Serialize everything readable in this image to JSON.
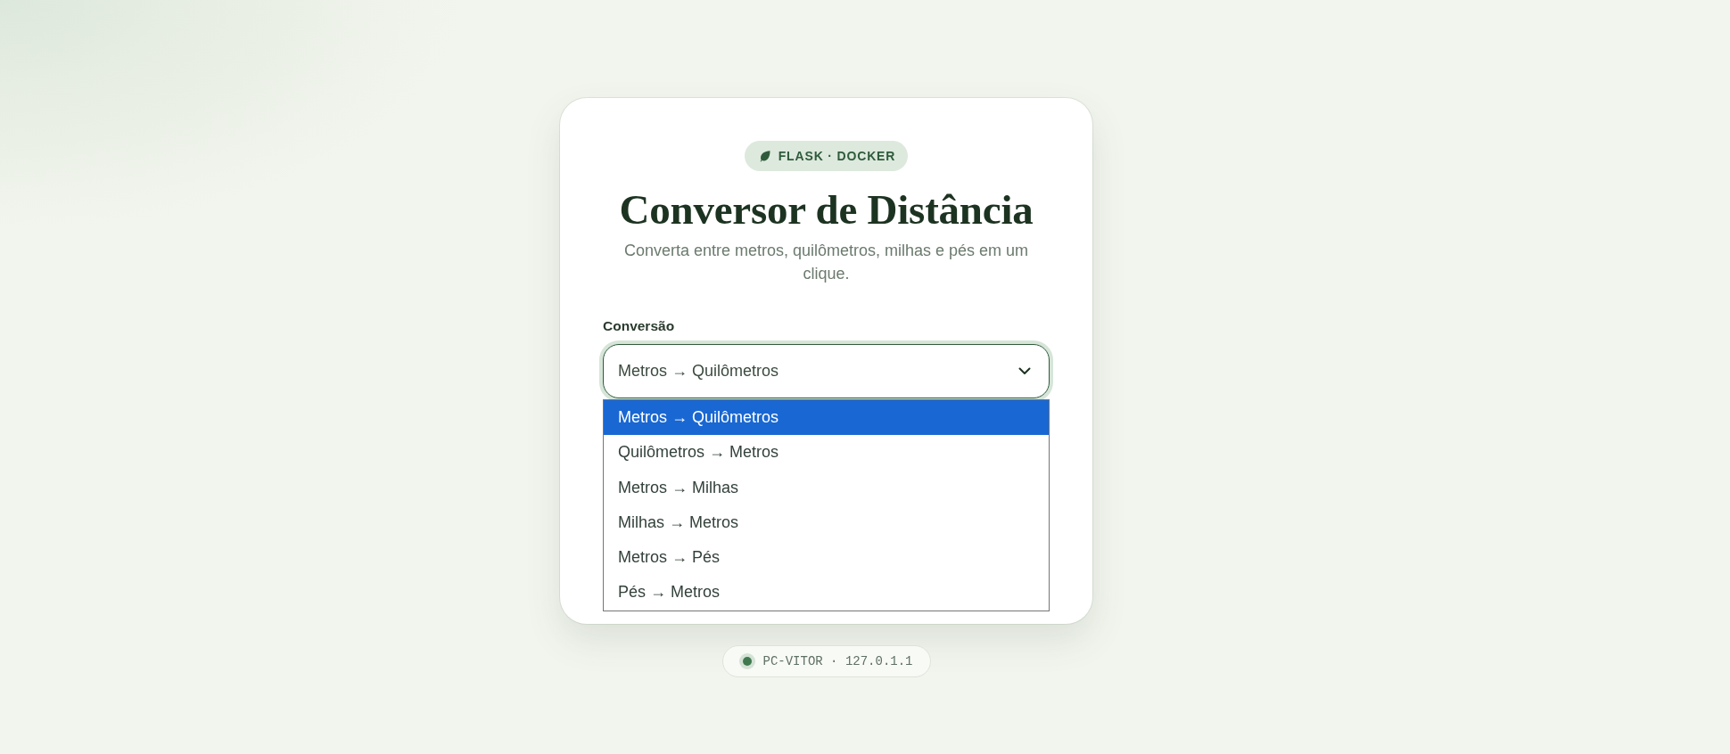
{
  "badge": {
    "text": "FLASK · DOCKER"
  },
  "title": "Conversor de Distância",
  "subtitle": "Converta entre metros, quilômetros, milhas e pés em um clique.",
  "conversion": {
    "label": "Conversão",
    "value": "Metros → Quilômetros",
    "expanded": true,
    "options": [
      {
        "label": "Metros → Quilômetros",
        "selected": true
      },
      {
        "label": "Quilômetros → Metros",
        "selected": false
      },
      {
        "label": "Metros → Milhas",
        "selected": false
      },
      {
        "label": "Milhas → Metros",
        "selected": false
      },
      {
        "label": "Metros → Pés",
        "selected": false
      },
      {
        "label": "Pés → Metros",
        "selected": false
      }
    ]
  },
  "footer": {
    "host": "PC-VITOR · 127.0.1.1"
  }
}
